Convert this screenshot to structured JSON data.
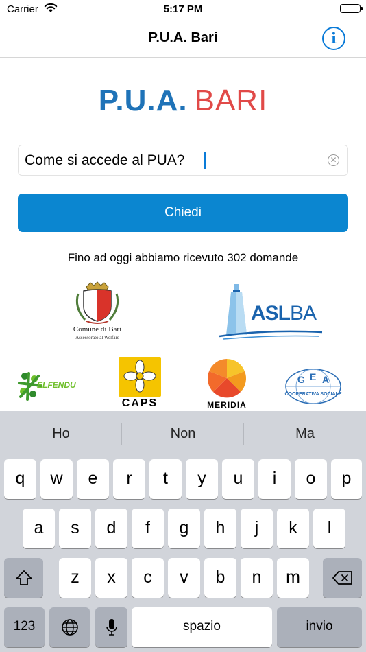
{
  "status_bar": {
    "carrier": "Carrier",
    "time": "5:17 PM"
  },
  "nav": {
    "title": "P.U.A. Bari",
    "info_icon": "info-icon"
  },
  "logo": {
    "pua": "P.U.A.",
    "bari": "BARI"
  },
  "question": {
    "value": "Come si accede al PUA?",
    "clear_icon": "clear-icon"
  },
  "ask_button": {
    "label": "Chiedi"
  },
  "count_text": "Fino ad oggi abbiamo ricevuto 302 domande",
  "partners": {
    "comune": {
      "name": "Comune di Bari",
      "subtitle": "Assessorato al Welfare"
    },
    "asl": {
      "asl": "ASL",
      "ba": "BA"
    },
    "elfendu": {
      "name": "ELFENDU"
    },
    "caps": {
      "name": "CAPS"
    },
    "meridia": {
      "name": "MERIDIA"
    },
    "gea": {
      "letters": [
        "G",
        "E",
        "A"
      ],
      "subtitle": "COOPERATIVA SOCIALE"
    }
  },
  "colors": {
    "accent": "#0a7bd8",
    "button": "#0b86d0",
    "logo_blue": "#1f73b8",
    "logo_red": "#e14a48",
    "keyboard_bg": "#d1d4da"
  },
  "keyboard": {
    "suggestions": [
      "Ho",
      "Non",
      "Ma"
    ],
    "row1": [
      "q",
      "w",
      "e",
      "r",
      "t",
      "y",
      "u",
      "i",
      "o",
      "p"
    ],
    "row2": [
      "a",
      "s",
      "d",
      "f",
      "g",
      "h",
      "j",
      "k",
      "l"
    ],
    "row3": [
      "z",
      "x",
      "c",
      "v",
      "b",
      "n",
      "m"
    ],
    "numbers_label": "123",
    "space_label": "spazio",
    "return_label": "invio",
    "icons": {
      "shift": "shift-icon",
      "delete": "delete-icon",
      "globe": "globe-icon",
      "mic": "microphone-icon"
    }
  }
}
